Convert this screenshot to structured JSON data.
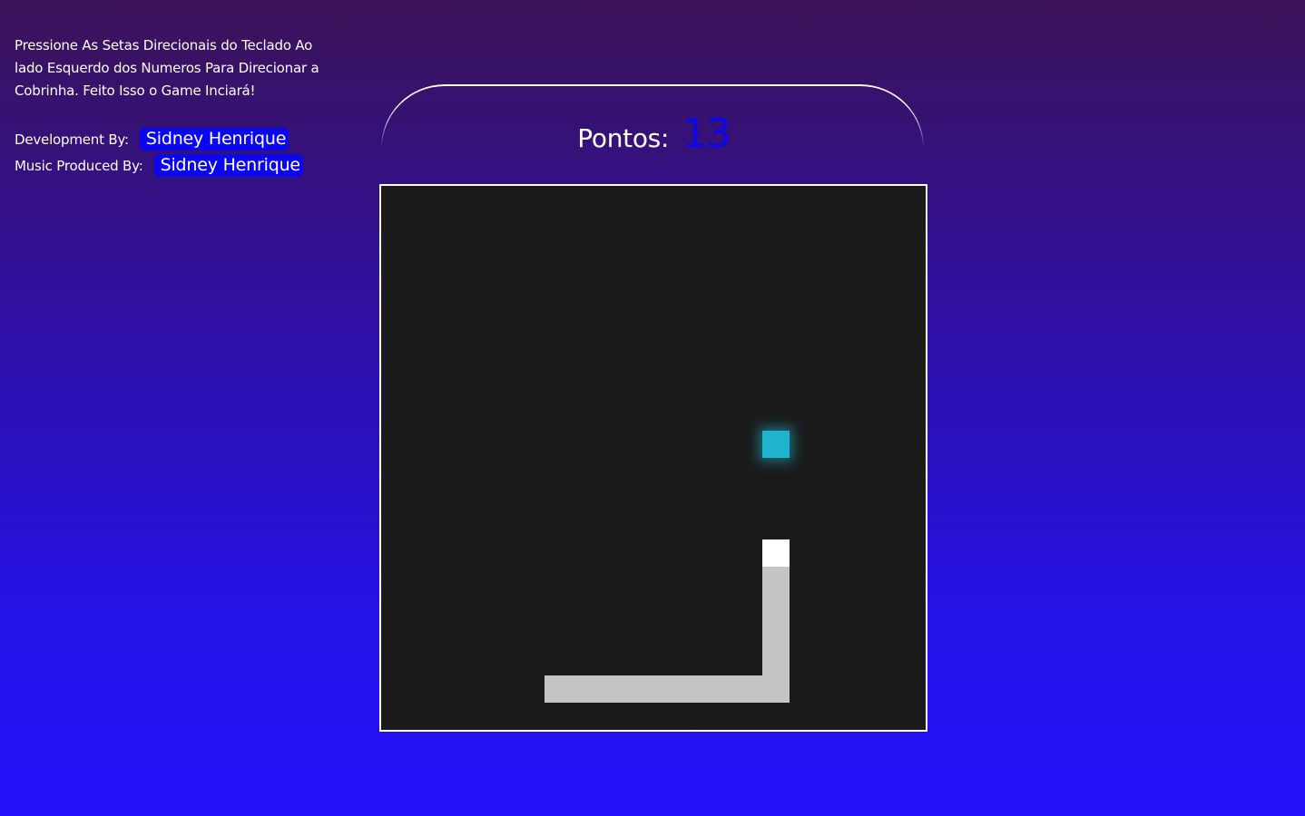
{
  "info": {
    "instructions": "Pressione As Setas Direcionais do Teclado Ao lado Esquerdo dos Numeros Para Direcionar a Cobrinha. Feito Isso o Game Inciará!",
    "credits": [
      {
        "label": "Development By:",
        "name": "Sidney Henrique"
      },
      {
        "label": "Music Produced By:",
        "name": "Sidney Henrique"
      }
    ]
  },
  "score": {
    "label": "Pontos:",
    "value": "13"
  },
  "game": {
    "grid_cols": 20,
    "grid_rows": 20,
    "food": {
      "col": 14,
      "row": 9,
      "color": "#1fb3cd"
    },
    "snake_head": {
      "col": 14,
      "row": 13,
      "color": "#ffffff"
    },
    "snake_body_color": "#c4c4c4",
    "snake_body": [
      {
        "col": 14,
        "row": 14
      },
      {
        "col": 14,
        "row": 15
      },
      {
        "col": 14,
        "row": 16
      },
      {
        "col": 14,
        "row": 17
      },
      {
        "col": 13,
        "row": 18
      },
      {
        "col": 12,
        "row": 18
      },
      {
        "col": 11,
        "row": 18
      },
      {
        "col": 10,
        "row": 18
      },
      {
        "col": 9,
        "row": 18
      },
      {
        "col": 8,
        "row": 18
      },
      {
        "col": 7,
        "row": 18
      },
      {
        "col": 6,
        "row": 18
      },
      {
        "col": 14,
        "row": 18
      }
    ]
  },
  "colors": {
    "accent": "#0a06ee",
    "board_bg": "#1b1b1b"
  }
}
